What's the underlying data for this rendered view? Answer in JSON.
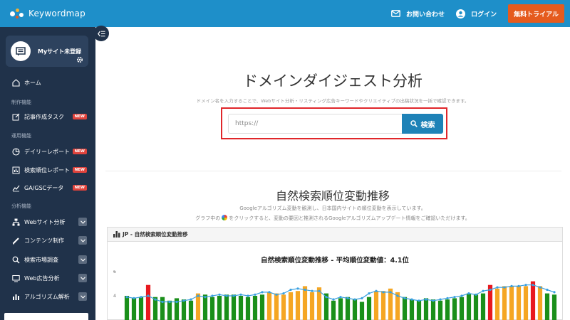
{
  "header": {
    "logo_text": "Keywordmap",
    "contact_label": "お問い合わせ",
    "login_label": "ログイン",
    "trial_label": "無料トライアル"
  },
  "sidebar": {
    "mysite_label": "Myサイト未登録",
    "home_label": "ホーム",
    "section_seisaku": "制作機能",
    "article_task_label": "記事作成タスク",
    "section_unyo": "運用機能",
    "daily_report_label": "デイリーレポート",
    "rank_report_label": "検索順位レポート",
    "ga_gsc_label": "GA/GSCデータ",
    "section_bunseki": "分析機能",
    "website_analysis_label": "Webサイト分析",
    "content_label": "コンテンツ制作",
    "market_label": "検索市場調査",
    "ad_label": "Web広告分析",
    "algo_label": "アルゴリズム解析",
    "new_badge": "NEW"
  },
  "main": {
    "title": "ドメインダイジェスト分析",
    "description": "ドメイン名を入力することで、Webサイト分析・リスティング広告キーワードやクリエイティブの出稿状況を一括で確認できます。",
    "search_placeholder": "https://",
    "search_button": "検索",
    "section_title": "自然検索順位変動推移",
    "section_desc1": "Googleアルゴリズム変動を観測し、日本国内サイトの順位変動を表示しています。",
    "section_desc2_a": "グラフ中の",
    "section_desc2_b": "をクリックすると、変動の要因と推測されるGoogleアルゴリズムアップデート情報をご確認いただけます。",
    "panel_header": "JP - 自然検索順位変動推移",
    "chart_title": "自然検索順位変動推移 - 平均順位変動値：4.1位"
  },
  "chart_data": {
    "type": "bar",
    "ytick_labels": [
      "6",
      "4"
    ],
    "values": [
      4.0,
      3.8,
      3.9,
      4.9,
      3.9,
      3.9,
      3.6,
      3.8,
      3.7,
      3.6,
      4.2,
      4.1,
      3.9,
      4.0,
      4.1,
      4.1,
      4.0,
      3.9,
      4.0,
      4.1,
      4.3,
      4.2,
      4.1,
      4.3,
      4.4,
      4.8,
      4.3,
      4.7,
      4.2,
      3.6,
      3.8,
      3.9,
      3.7,
      3.5,
      3.9,
      4.4,
      4.4,
      4.6,
      4.3,
      3.9,
      3.7,
      3.6,
      3.8,
      3.7,
      3.6,
      3.7,
      3.8,
      3.9,
      4.2,
      4.1,
      4.2,
      4.9,
      4.6,
      4.8,
      4.8,
      4.8,
      4.8,
      5.2,
      4.8,
      4.2,
      4.1
    ],
    "status": [
      "g",
      "g",
      "g",
      "r",
      "g",
      "g",
      "g",
      "g",
      "g",
      "g",
      "o",
      "g",
      "g",
      "g",
      "g",
      "g",
      "g",
      "g",
      "g",
      "g",
      "o",
      "o",
      "o",
      "o",
      "o",
      "o",
      "o",
      "o",
      "g",
      "g",
      "g",
      "g",
      "g",
      "g",
      "g",
      "o",
      "o",
      "o",
      "o",
      "g",
      "g",
      "g",
      "g",
      "g",
      "g",
      "g",
      "g",
      "g",
      "g",
      "g",
      "g",
      "r",
      "o",
      "o",
      "o",
      "o",
      "o",
      "r",
      "o",
      "g",
      "g"
    ],
    "line_values": [
      3.9,
      3.8,
      3.9,
      4.0,
      3.7,
      3.5,
      3.5,
      3.5,
      3.6,
      3.7,
      4.0,
      3.9,
      4.0,
      4.1,
      4.0,
      4.0,
      4.1,
      4.0,
      4.1,
      4.3,
      4.3,
      4.1,
      4.2,
      4.5,
      4.6,
      4.5,
      4.4,
      4.4,
      3.9,
      3.7,
      3.9,
      3.8,
      3.7,
      3.8,
      4.2,
      4.4,
      4.3,
      4.3,
      4.0,
      3.8,
      3.7,
      3.6,
      3.7,
      3.6,
      3.7,
      3.8,
      3.9,
      4.0,
      4.2,
      4.1,
      4.4,
      4.5,
      4.7,
      4.7,
      4.8,
      4.8,
      4.9,
      4.9,
      4.7,
      4.5,
      4.3
    ],
    "colors": {
      "g": "#1a8f1a",
      "o": "#f5a623",
      "r": "#e8191f",
      "line": "#3aa0e0"
    }
  }
}
